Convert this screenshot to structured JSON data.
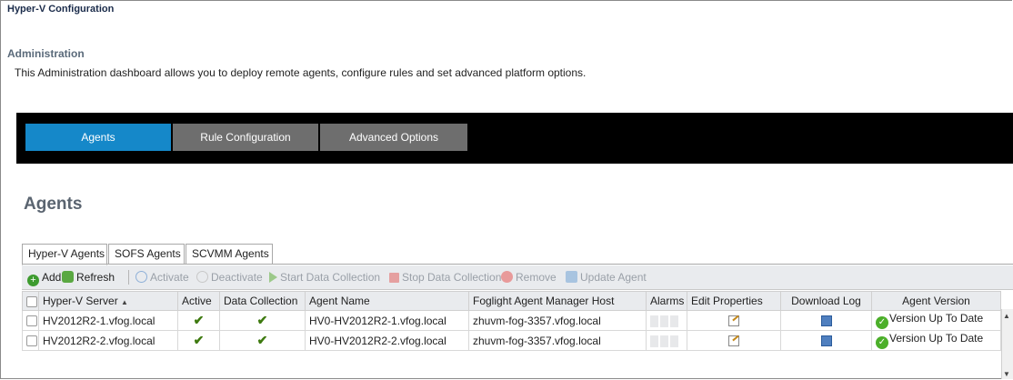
{
  "window": {
    "title": "Hyper-V Configuration"
  },
  "section": {
    "title": "Administration",
    "description": "This Administration dashboard allows you to deploy remote agents, configure rules and set advanced platform options."
  },
  "nav": {
    "tabs": [
      {
        "label": "Agents",
        "active": true
      },
      {
        "label": "Rule Configuration",
        "active": false
      },
      {
        "label": "Advanced Options",
        "active": false
      }
    ]
  },
  "page": {
    "heading": "Agents"
  },
  "subtabs": [
    {
      "label": "Hyper-V Agents",
      "active": true
    },
    {
      "label": "SOFS Agents",
      "active": false
    },
    {
      "label": "SCVMM Agents",
      "active": false
    }
  ],
  "toolbar": {
    "add": "Add",
    "refresh": "Refresh",
    "activate": "Activate",
    "deactivate": "Deactivate",
    "start_collection": "Start Data Collection",
    "stop_collection": "Stop Data Collection",
    "remove": "Remove",
    "update_agent": "Update Agent"
  },
  "table": {
    "columns": {
      "server": "Hyper-V Server",
      "active": "Active",
      "collection": "Data Collection",
      "agent_name": "Agent Name",
      "host": "Foglight Agent Manager Host",
      "alarms": "Alarms",
      "edit": "Edit Properties",
      "log": "Download Log",
      "version": "Agent Version"
    },
    "sort_icon": "sort-ascending-icon",
    "rows": [
      {
        "server": "HV2012R2-1.vfog.local",
        "agent_name": "HV0-HV2012R2-1.vfog.local",
        "host": "zhuvm-fog-3357.vfog.local",
        "version": "Version Up To Date"
      },
      {
        "server": "HV2012R2-2.vfog.local",
        "agent_name": "HV0-HV2012R2-2.vfog.local",
        "host": "zhuvm-fog-3357.vfog.local",
        "version": "Version Up To Date"
      }
    ]
  },
  "colors": {
    "nav_active": "#1588c9",
    "nav_inactive": "#6e6e6e",
    "nav_bar": "#000000",
    "ok_green": "#4caf2a"
  }
}
